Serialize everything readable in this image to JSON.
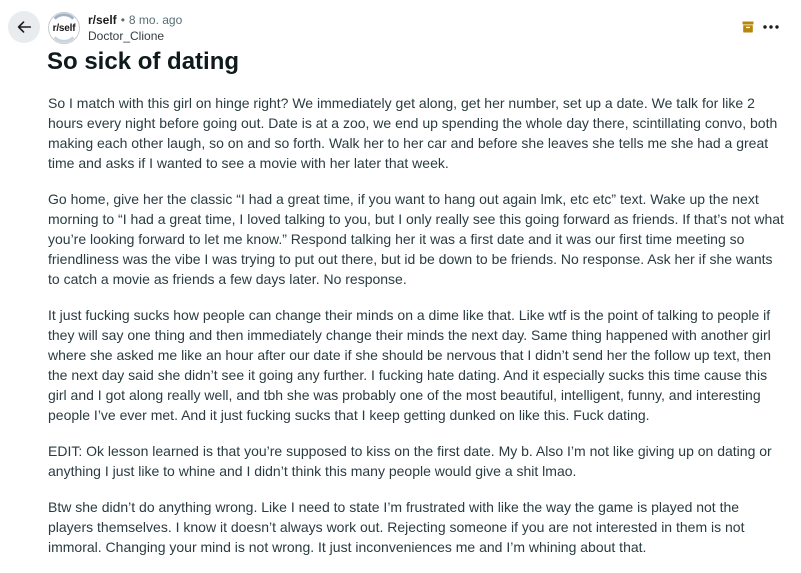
{
  "header": {
    "subreddit": "r/self",
    "separator": "•",
    "age": "8 mo. ago",
    "author": "Doctor_Clione",
    "avatar_text": "r/self"
  },
  "post": {
    "title": "So sick of dating",
    "paragraphs": [
      "So I match with this girl on hinge right? We immediately get along, get her number, set up a date. We talk for like 2 hours every night before going out. Date is at a zoo, we end up spending the whole day there, scintillating convo, both making each other laugh, so on and so forth. Walk her to her car and before she leaves she tells me she had a great time and asks if I wanted to see a movie with her later that week.",
      "Go home, give her the classic “I had a great time, if you want to hang out again lmk, etc etc” text. Wake up the next morning to “I had a great time, I loved talking to you, but I only really see this going forward as friends. If that’s not what you’re looking forward to let me know.” Respond talking her it was a first date and it was our first time meeting so friendliness was the vibe I was trying to put out there, but id be down to be friends. No response. Ask her if she wants to catch a movie as friends a few days later. No response.",
      "It just fucking sucks how people can change their minds on a dime like that. Like wtf is the point of talking to people if they will say one thing and then immediately change their minds the next day. Same thing happened with another girl where she asked me like an hour after our date if she should be nervous that I didn’t send her the follow up text, then the next day said she didn’t see it going any further. I fucking hate dating. And it especially sucks this time cause this girl and I got along really well, and tbh she was probably one of the most beautiful, intelligent, funny, and interesting people I’ve ever met. And it just fucking sucks that I keep getting dunked on like this. Fuck dating.",
      "EDIT: Ok lesson learned is that you’re supposed to kiss on the first date. My b. Also I’m not like giving up on dating or anything I just like to whine and I didn’t think this many people would give a shit lmao.",
      "Btw she didn’t do anything wrong. Like I need to state I’m frustrated with like the way the game is played not the players themselves. I know it doesn’t always work out. Rejecting someone if you are not interested in them is not immoral. Changing your mind is not wrong. It just inconveniences me and I’m whining about that."
    ]
  },
  "icons": {
    "back": "arrow-left-icon",
    "archive": "archive-icon",
    "more": "more-options-icon"
  },
  "colors": {
    "archive_accent": "#b8860b",
    "back_bg": "#e9ecee",
    "meta_gray": "#576f76"
  }
}
